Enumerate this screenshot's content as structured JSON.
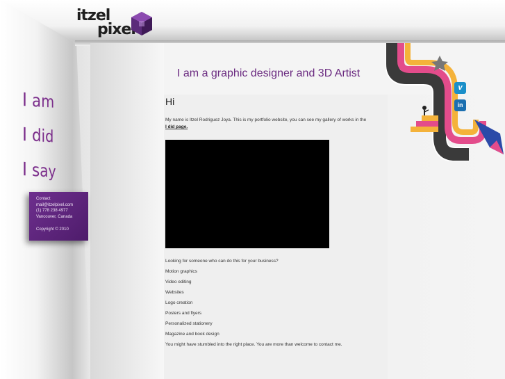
{
  "logo": {
    "line1": "itzel",
    "line2": "pixel"
  },
  "nav": [
    {
      "label": "I am"
    },
    {
      "label": "I did"
    },
    {
      "label": "I say"
    }
  ],
  "contact": {
    "title": "Contact",
    "email": "mail@itzelpixel.com",
    "phone": "(1) 778 238 4977",
    "location": "Vancouver, Canada",
    "copyright": "Copyright © 2010"
  },
  "headline": "I am a graphic designer and 3D Artist",
  "main": {
    "greeting": "Hi",
    "intro_text": "My name is Itzel Rodriguez Joya. This is my portfolio website, you can see my gallery of works in the ",
    "intro_link": "I did page.",
    "services": [
      "Looking for someone who can do this for your business?",
      "Motion graphics",
      "Video editing",
      "Websites",
      "Logo creation",
      "Posters and flyers",
      "Personalized stationery",
      "Magazine and book design",
      "You might have stumbled into the right place. You are more than welcome to contact me."
    ]
  },
  "social": {
    "vimeo_glyph": "v",
    "linkedin_glyph": "in"
  },
  "colors": {
    "brand_purple": "#6a2a80",
    "vimeo": "#1a8fc9",
    "linkedin": "#1b6fb0"
  }
}
